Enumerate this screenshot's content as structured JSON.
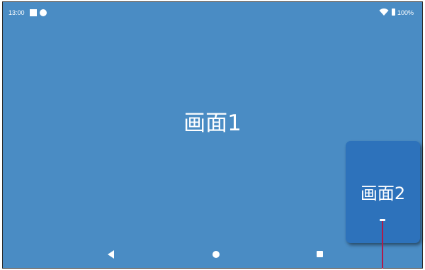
{
  "status_bar": {
    "time": "13:00",
    "battery_text": "100%",
    "icons": [
      "notification-square-icon",
      "notification-dot-icon",
      "wifi-icon",
      "battery-icon"
    ]
  },
  "screen1": {
    "label": "画面1"
  },
  "screen2": {
    "label": "画面2"
  },
  "nav_bar": {
    "icons": [
      "back-icon",
      "home-icon",
      "recents-icon"
    ]
  },
  "colors": {
    "screen1_bg": "#4a8cc4",
    "screen2_bg": "#2d72bb",
    "handle_line": "#b01a4a"
  }
}
